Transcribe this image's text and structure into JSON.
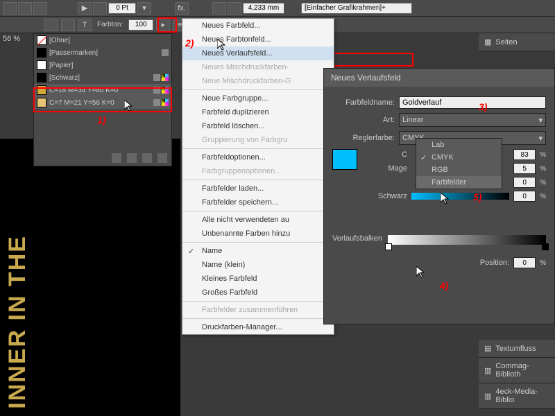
{
  "toolbar": {
    "pt_value": "0 Pt",
    "mm_value": "4,233 mm",
    "frame_style": "[Einfacher Grafikrahmen]+",
    "farbton_label": "Farbton:",
    "farbton_value": "100",
    "zoom": "56 %"
  },
  "swatches": {
    "items": [
      {
        "label": "[Ohne]",
        "color": "transparent"
      },
      {
        "label": "[Passermarken]",
        "color": "#000"
      },
      {
        "label": "[Papier]",
        "color": "#fff"
      },
      {
        "label": "[Schwarz]",
        "color": "#000"
      },
      {
        "label": "C=18 M=34 Y=80 K=0",
        "color": "#d4a83a"
      },
      {
        "label": "C=7 M=21 Y=56 K=0",
        "color": "#e8c676"
      }
    ]
  },
  "menu": {
    "items": [
      {
        "label": "Neues Farbfeld...",
        "disabled": false
      },
      {
        "label": "Neues Farbtonfeld...",
        "disabled": false
      },
      {
        "label": "Neues Verlaufsfeld...",
        "hover": true
      },
      {
        "label": "Neues Mischdruckfarben-",
        "disabled": true
      },
      {
        "label": "Neue Mischdruckfarben-G",
        "disabled": true
      },
      {
        "sep": true
      },
      {
        "label": "Neue Farbgruppe...",
        "disabled": false
      },
      {
        "label": "Farbfeld duplizieren",
        "disabled": false
      },
      {
        "label": "Farbfeld löschen...",
        "disabled": false
      },
      {
        "label": "Gruppierung von Farbgru",
        "disabled": true
      },
      {
        "sep": true
      },
      {
        "label": "Farbfeldoptionen...",
        "disabled": false
      },
      {
        "label": "Farbgruppenoptionen...",
        "disabled": true
      },
      {
        "sep": true
      },
      {
        "label": "Farbfelder laden...",
        "disabled": false
      },
      {
        "label": "Farbfelder speichern...",
        "disabled": false
      },
      {
        "sep": true
      },
      {
        "label": "Alle nicht verwendeten au",
        "disabled": false
      },
      {
        "label": "Unbenannte Farben hinzu",
        "disabled": false
      },
      {
        "sep": true
      },
      {
        "label": "Name",
        "checked": true
      },
      {
        "label": "Name (klein)",
        "disabled": false
      },
      {
        "label": "Kleines Farbfeld",
        "disabled": false
      },
      {
        "label": "Großes Farbfeld",
        "disabled": false
      },
      {
        "sep": true
      },
      {
        "label": "Farbfelder zusammenführen",
        "disabled": true
      },
      {
        "sep": true
      },
      {
        "label": "Druckfarben-Manager...",
        "disabled": false
      }
    ]
  },
  "dialog": {
    "title": "Neues Verlaufsfeld",
    "name_label": "Farbfeldname:",
    "name_value": "Goldverlauf",
    "art_label": "Art:",
    "art_value": "Linear",
    "reglerfarbe_label": "Reglerfarbe:",
    "reglerfarbe_value": "CMYK",
    "dropdown": [
      "Lab",
      "CMYK",
      "RGB",
      "Farbfelder"
    ],
    "dropdown_selected": "CMYK",
    "dropdown_hover": "Farbfelder",
    "sliders": {
      "cyan_label": "C",
      "cyan_value": "83",
      "magenta_label": "Mage",
      "magenta_value": "5",
      "yellow_label": "",
      "yellow_value": "0",
      "schwarz_label": "Schwarz",
      "schwarz_value": "0"
    },
    "verlaufsbalken_label": "Verlaufsbalken",
    "position_label": "Position:",
    "position_value": "0"
  },
  "right_panels": {
    "seiten": "Seiten",
    "textumfluss": "Textumfluss",
    "commag": "Commag-Biblioth",
    "media": "4eck-Media-Biblio"
  },
  "annotations": {
    "a1": "1)",
    "a2": "2)",
    "a3": "3)",
    "a4": "4)",
    "a5": "5)"
  },
  "bg_text": "INNER IN THE"
}
